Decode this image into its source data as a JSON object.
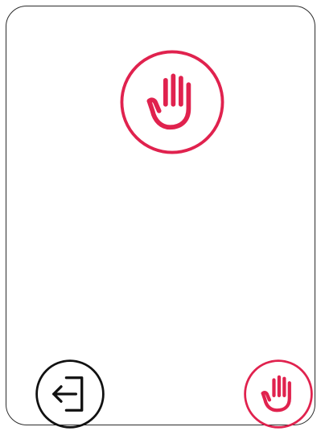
{
  "colors": {
    "accent": "#e0224e",
    "outline": "#111111",
    "card_border": "#2b2b2b",
    "background": "#ffffff"
  },
  "icons": {
    "primary": "raised-hand-icon",
    "exit": "exit-door-arrow-icon",
    "secondary": "raised-hand-icon"
  }
}
